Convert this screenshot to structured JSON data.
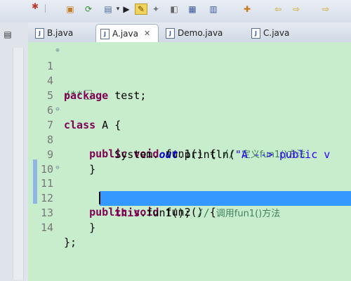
{
  "toolbar": {
    "icons": [
      "debug-icon",
      "separator",
      "toolbox-icon",
      "run-icon",
      "save-icon",
      "dropdown-icon",
      "step-icon",
      "highlight-icon",
      "pin-icon",
      "sync-icon",
      "terminal-icon",
      "window-icon",
      "navigate-icon",
      "back-icon",
      "forward-icon"
    ]
  },
  "tabs": [
    {
      "label": "B.java",
      "active": false
    },
    {
      "label": "A.java",
      "active": true
    },
    {
      "label": "Demo.java",
      "active": false
    },
    {
      "label": "C.java",
      "active": false
    }
  ],
  "editor": {
    "lines": [
      {
        "num": "1",
        "fold": "⊕",
        "kind": "comment_block",
        "text": "/**"
      },
      {
        "num": "4",
        "kind": "package",
        "kw": "package",
        "rest": " test;"
      },
      {
        "num": "5",
        "kind": "blank"
      },
      {
        "num": "6",
        "kind": "class",
        "kw": "class",
        "rest": " A {"
      },
      {
        "num": "7",
        "fold": "⊖",
        "kind": "method",
        "indent": "    ",
        "kw1": "public",
        "kw2": "void",
        "rest": " fun1() { ",
        "comment": "// ",
        "comment_cn": "定义fun1()方法"
      },
      {
        "num": "8",
        "kind": "println",
        "indent": "        ",
        "pre": "System.",
        "field": "out",
        "post": ".println(",
        "str": "\"A --> public v"
      },
      {
        "num": "9",
        "kind": "plain",
        "text": "    }"
      },
      {
        "num": "10",
        "kind": "blank"
      },
      {
        "num": "11",
        "fold": "⊖",
        "kind": "method2",
        "indent": "    ",
        "kw1": "public",
        "kw2": "void",
        "rest": " fun2() {"
      },
      {
        "num": "12",
        "kind": "thiscall",
        "indent": "        ",
        "kw": "this",
        "rest": ".fun1(); ",
        "comment": "// ",
        "comment_cn": "调用fun1()方法"
      },
      {
        "num": "13",
        "kind": "selected",
        "text": "    }"
      },
      {
        "num": "14",
        "kind": "plain",
        "text": "};"
      }
    ]
  }
}
